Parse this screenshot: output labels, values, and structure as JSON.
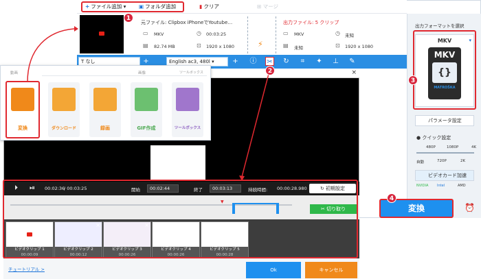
{
  "toolbar": {
    "add_file": "ファイル追加",
    "add_folder": "フォルダ追加",
    "clear": "クリア",
    "merge": "マージ"
  },
  "source": {
    "label": "元ファイル: Clipbox iPhoneでYoutube…",
    "format": "MKV",
    "duration": "00:03:25",
    "size": "82.74 MB",
    "resolution": "1920 x 1080"
  },
  "output": {
    "label": "出力ファイル: 5 クリップ",
    "format": "MKV",
    "duration": "未知",
    "size": "未知",
    "resolution": "1920 x 1080"
  },
  "bar": {
    "subtitle": "なし",
    "audio": "English ac3, 480l"
  },
  "right": {
    "heading": "出力フォーマットを選択",
    "format": "MKV",
    "logo_text": "MKV",
    "logo_sub": "MATROŠKA",
    "param": "パラメータ設定",
    "quick": "クイック設定",
    "quality_top": [
      "480P",
      "1080P",
      "4K"
    ],
    "quality_bottom": [
      "自動",
      "720P",
      "2K"
    ],
    "gpu": "ビデオカード加速",
    "nvidia": "NVIDIA",
    "intel": "Intel",
    "amd": "AMD",
    "convert": "変換"
  },
  "popup": {
    "section_video": "動画",
    "section_image": "画像",
    "section_toolbox": "ツールボックス",
    "cards": [
      "変換",
      "ダウンロード",
      "録画",
      "GIF作成",
      "ツールボックス"
    ]
  },
  "clip": {
    "current": "00:02:36",
    "total": "/ 00:03:25",
    "start_label": "開始",
    "start": "00:02:44",
    "end_label": "終了",
    "end": "00:03:13",
    "dur_label": "持続時間:",
    "dur": "00:00:28.980",
    "reset": "初期設定",
    "cut": "切り取り",
    "clips": [
      {
        "name": "ビデオクリップ 1",
        "time": "00:00:09"
      },
      {
        "name": "ビデオクリップ 2",
        "time": "00:00:12"
      },
      {
        "name": "ビデオクリップ 3",
        "time": "00:00:26"
      },
      {
        "name": "ビデオクリップ 4",
        "time": "00:00:26"
      },
      {
        "name": "ビデオクリップ 5",
        "time": "00:00:28"
      }
    ],
    "tutorial": "チュートリアル >",
    "ok": "Ok",
    "cancel": "キャンセル"
  },
  "markers": [
    "1",
    "2",
    "3",
    "4"
  ],
  "colors": {
    "accent": "#1e90ef",
    "highlight": "#e0282f",
    "orange": "#f0891a",
    "green": "#2fb84a"
  }
}
